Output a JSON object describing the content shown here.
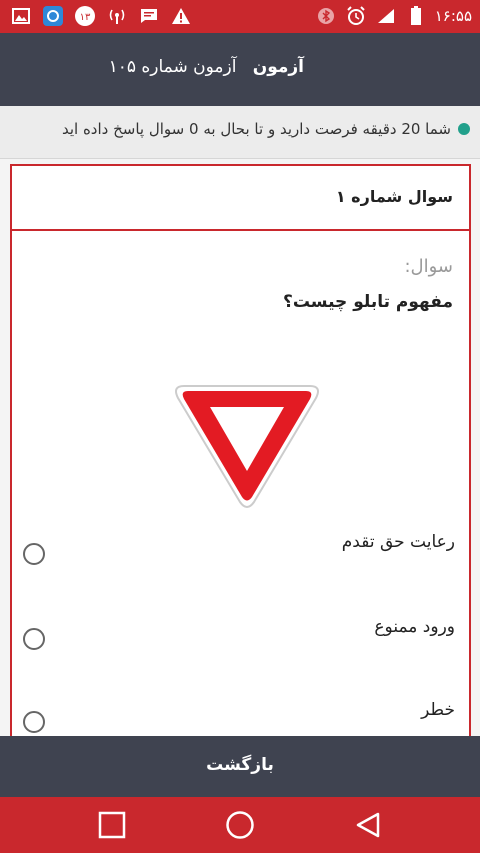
{
  "status_bar": {
    "time": "۱۶:۵۵",
    "badge_count": "۱۳"
  },
  "header": {
    "prefix": "آزمون شماره ۱۰۵",
    "title": "آزمون"
  },
  "info": {
    "text": "شما 20 دقیقه فرصت دارید و تا بحال به 0 سوال پاسخ داده اید"
  },
  "question": {
    "heading": "سوال شماره ۱",
    "label": "سوال:",
    "text": "مفهوم تابلو چیست؟",
    "image_icon": "yield-sign-icon",
    "options": [
      {
        "label": "رعایت حق تقدم",
        "selected": false
      },
      {
        "label": "ورود ممنوع",
        "selected": false
      },
      {
        "label": "خطر",
        "selected": false
      }
    ]
  },
  "footer": {
    "back_label": "بازگشت"
  },
  "colors": {
    "accent": "#c9282d",
    "dark": "#3f4350",
    "dot": "#21a08b"
  }
}
